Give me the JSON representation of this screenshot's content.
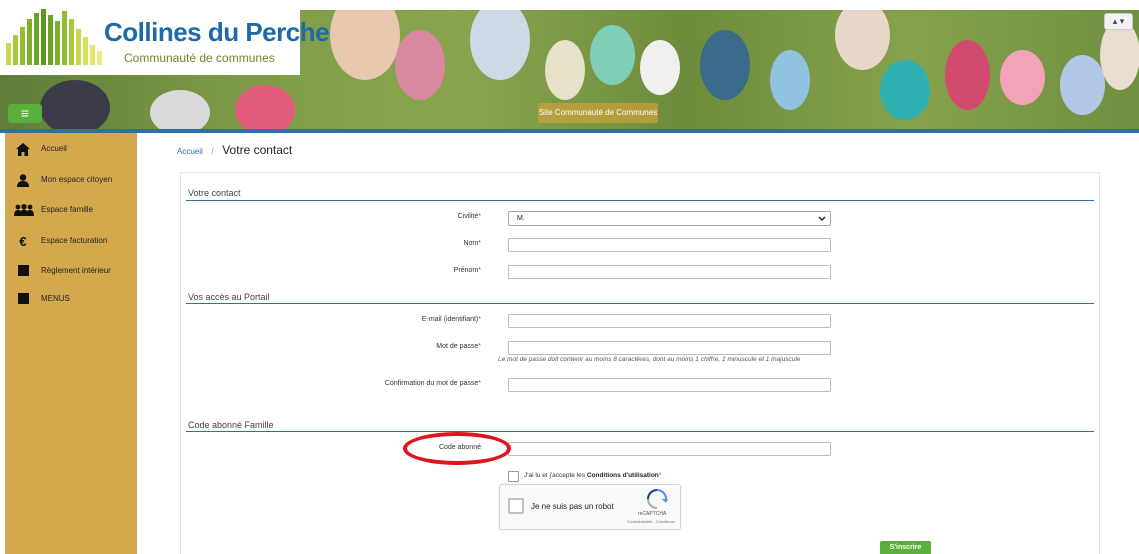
{
  "header": {
    "logo_title": "Collines du Perche",
    "logo_subtitle": "Communauté de communes",
    "site_label": "Site Communauté de Communes",
    "menu_toggle_icon": "≡",
    "user_menu": "▴ ▾"
  },
  "sidebar": {
    "items": [
      {
        "label": "Accueil",
        "icon": "home-icon"
      },
      {
        "label": "Mon espace citoyen",
        "icon": "user-icon"
      },
      {
        "label": "Espace famille",
        "icon": "family-icon"
      },
      {
        "label": "Espace facturation",
        "icon": "euro-icon"
      },
      {
        "label": "Règlement intérieur",
        "icon": "square-icon"
      },
      {
        "label": "MENUS",
        "icon": "square-icon"
      }
    ]
  },
  "breadcrumb": {
    "home": "Accueil",
    "separator": "/",
    "current": "Votre contact"
  },
  "form": {
    "section_contact": "Votre contact",
    "civilite_label": "Civilité",
    "civilite_value": "M.",
    "nom_label": "Nom",
    "prenom_label": "Prénom",
    "section_portail": "Vos accès au Portail",
    "email_label": "E-mail (identifiant)",
    "password_label": "Mot de passe",
    "password_hint": "Le mot de passe doit contenir au moins 8 caractères, dont au moins 1 chiffre, 1 minuscule et 1 majuscule",
    "confirm_label": "Confirmation du mot de passe",
    "section_code": "Code abonné Famille",
    "code_label": "Code abonné",
    "required_mark": "*",
    "cgu_prefix": "J'ai lu et j'accepte les",
    "cgu_link": "Conditions d'utilisation",
    "recaptcha_label": "Je ne suis pas un robot",
    "recaptcha_brand": "reCAPTCHA",
    "recaptcha_links": "Confidentialité - Conditions",
    "submit_label": "S'inscrire"
  },
  "colors": {
    "sidebar_bg": "#d4a84c",
    "accent_blue": "#2f6fa8",
    "button_green": "#5aaf3a",
    "highlight_red": "#e0141c"
  }
}
